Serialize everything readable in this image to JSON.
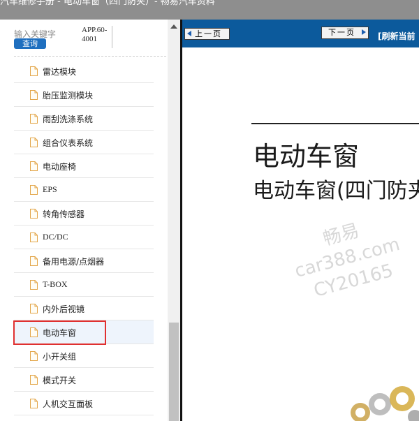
{
  "window": {
    "title": "汽车维修手册 - 电动车窗（四门防夹）- 畅易汽车资料"
  },
  "search": {
    "label": "输入关键字",
    "button_label": "查询",
    "app_code": "APP.60-4001"
  },
  "tree": {
    "items": [
      {
        "label": "雷达模块"
      },
      {
        "label": "胎压监测模块"
      },
      {
        "label": "雨刮洗涤系统"
      },
      {
        "label": "组合仪表系统"
      },
      {
        "label": "电动座椅"
      },
      {
        "label": "EPS"
      },
      {
        "label": "转角传感器"
      },
      {
        "label": "DC/DC"
      },
      {
        "label": "备用电源/点烟器"
      },
      {
        "label": "T-BOX"
      },
      {
        "label": "内外后视镜"
      },
      {
        "label": "电动车窗"
      },
      {
        "label": "小开关组"
      },
      {
        "label": "模式开关"
      },
      {
        "label": "人机交互面板"
      }
    ],
    "selected_index": 11
  },
  "toolbar": {
    "prev_label": "上一页",
    "next_label": "下一页",
    "refresh_label": "[刷新当前"
  },
  "document": {
    "title": "电动车窗",
    "subtitle": "电动车窗(四门防夹)"
  },
  "watermark": {
    "line1": "畅易",
    "line2": "car388.com",
    "line3": "CY20165"
  },
  "colors": {
    "toolbar_bg": "#0c5a9c",
    "selection_outline": "#e03030",
    "button_blue": "#1f6fbf"
  }
}
